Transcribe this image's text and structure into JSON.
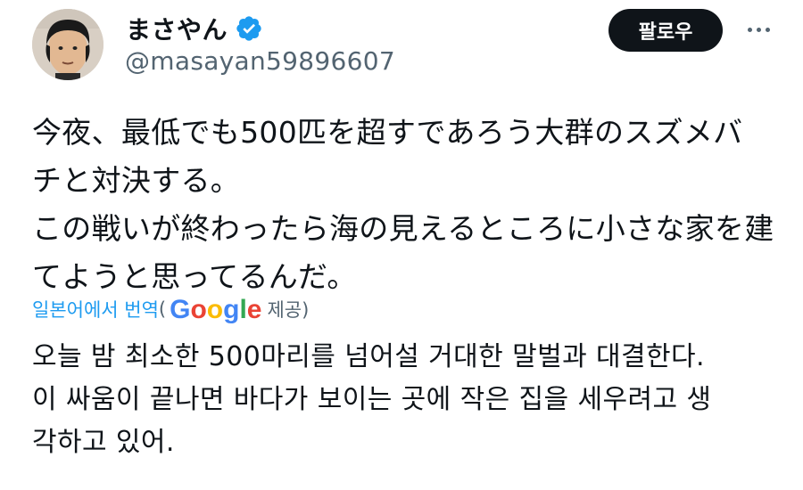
{
  "user": {
    "display_name": "まさやん",
    "handle": "@masayan59896607",
    "verified": true,
    "verified_color": "#1d9bf0"
  },
  "actions": {
    "follow_label": "팔로우",
    "more_icon": "more-horizontal-icon"
  },
  "tweet": {
    "lines": [
      "今夜、最低でも500匹を超すであろう大群のスズメバ",
      "チと対決する。",
      "この戦いが終わったら海の見えるところに小さな家を建",
      "てようと思ってるんだ。"
    ]
  },
  "translation": {
    "link_text": "일본어에서 번역",
    "open_paren": "(",
    "provider": "Google",
    "provided_text": "제공)",
    "lines": [
      "오늘 밤 최소한 500마리를 넘어설 거대한 말벌과 대결한다.",
      "이 싸움이 끝나면 바다가 보이는 곳에 작은 집을 세우려고 생",
      "각하고 있어."
    ]
  },
  "colors": {
    "text": "#0f1419",
    "secondary": "#536471",
    "link": "#1d9bf0",
    "button_bg": "#0f1419"
  }
}
